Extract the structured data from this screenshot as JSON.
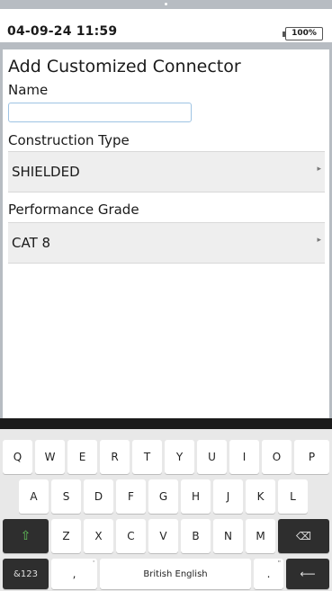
{
  "status_bar": {
    "datetime": "04-09-24 11:59",
    "battery": "100%"
  },
  "form": {
    "title": "Add Customized Connector",
    "name_label": "Name",
    "name_value": "",
    "construction_label": "Construction Type",
    "construction_value": "SHIELDED",
    "grade_label": "Performance Grade",
    "grade_value": "CAT 8"
  },
  "keyboard": {
    "row1": [
      "Q",
      "W",
      "E",
      "R",
      "T",
      "Y",
      "U",
      "I",
      "O",
      "P"
    ],
    "row2": [
      "A",
      "S",
      "D",
      "F",
      "G",
      "H",
      "J",
      "K",
      "L"
    ],
    "row3": [
      "Z",
      "X",
      "C",
      "V",
      "B",
      "N",
      "M"
    ],
    "shift_icon": "⇧",
    "backspace_icon": "⌫",
    "symbols_label": "&123",
    "comma": ",",
    "space_label": "British English",
    "period": ".",
    "enter_icon": "⟵",
    "comma_hint": "'",
    "period_hint": "\""
  }
}
